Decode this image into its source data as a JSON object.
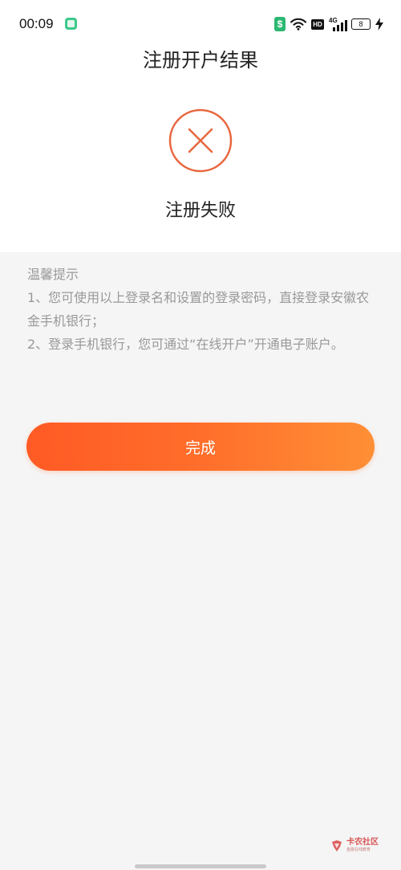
{
  "status_bar": {
    "time": "00:09",
    "network": "4G",
    "hd": "HD",
    "battery": "8"
  },
  "header": {
    "title": "注册开户结果"
  },
  "result": {
    "text": "注册失败",
    "icon_color": "#E8673F"
  },
  "tips": {
    "title": "温馨提示",
    "items": [
      "1、您可使用以上登录名和设置的登录密码，直接登录安徽农金手机银行；",
      "2、登录手机银行，您可通过“在线开户”开通电子账户。"
    ]
  },
  "done_button": {
    "label": "完成"
  },
  "watermark": {
    "name": "卡农社区",
    "subtitle": "金融在线教育"
  },
  "colors": {
    "accent_start": "#FF5A24",
    "accent_end": "#FF8F35",
    "background": "#F5F5F5"
  }
}
